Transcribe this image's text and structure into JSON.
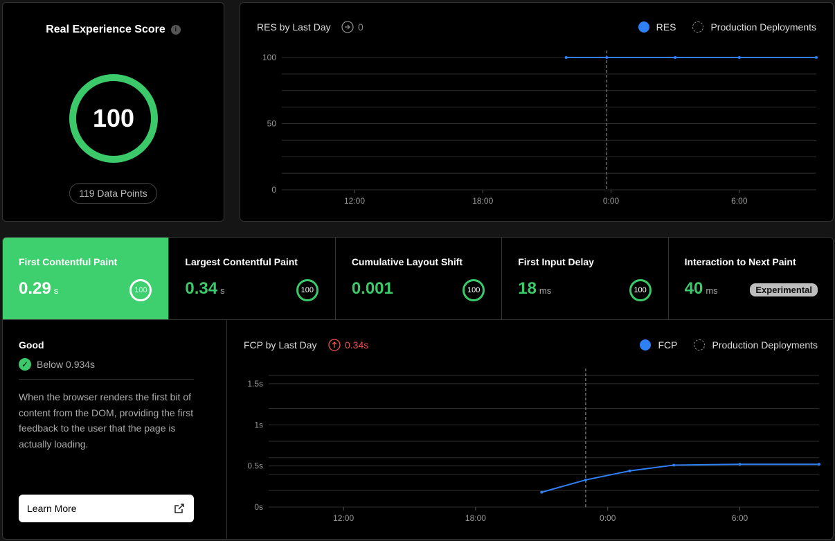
{
  "score_card": {
    "title": "Real Experience Score",
    "info_icon": "info-icon",
    "score": "100",
    "data_points": "119 Data Points",
    "color": "#3bc96a"
  },
  "res_chart": {
    "title": "RES by Last Day",
    "badge_icon": "arrow-right-circle-icon",
    "badge_value": "0",
    "legend": {
      "series": "RES",
      "deployments": "Production Deployments"
    }
  },
  "metrics": {
    "tabs": [
      {
        "label": "First Contentful Paint",
        "value": "0.29",
        "unit": "s",
        "score": "100",
        "active": true
      },
      {
        "label": "Largest Contentful Paint",
        "value": "0.34",
        "unit": "s",
        "score": "100",
        "active": false
      },
      {
        "label": "Cumulative Layout Shift",
        "value": "0.001",
        "unit": "",
        "score": "100",
        "active": false
      },
      {
        "label": "First Input Delay",
        "value": "18",
        "unit": "ms",
        "score": "100",
        "active": false
      },
      {
        "label": "Interaction to Next Paint",
        "value": "40",
        "unit": "ms",
        "badge": "Experimental",
        "active": false
      }
    ]
  },
  "description": {
    "status": "Good",
    "threshold": "Below 0.934s",
    "text": "When the browser renders the first bit of content from the DOM, providing the first feedback to the user that the page is actually loading.",
    "button": "Learn More",
    "button_icon": "external-link-icon"
  },
  "fcp_chart": {
    "title": "FCP by Last Day",
    "badge_icon": "arrow-up-circle-icon",
    "badge_value": "0.34s",
    "badge_color": "#f0524f",
    "legend": {
      "series": "FCP",
      "deployments": "Production Deployments"
    }
  },
  "chart_data": [
    {
      "type": "line",
      "title": "RES by Last Day",
      "x_ticks": [
        "12:00",
        "18:00",
        "0:00",
        "6:00"
      ],
      "y_ticks": [
        "100",
        "50",
        "0"
      ],
      "ylim": [
        0,
        100
      ],
      "x_range_hours": [
        8.6,
        33.6
      ],
      "series": [
        {
          "name": "RES",
          "color": "#2f7ff5",
          "x_hours": [
            21.9,
            23.8,
            27.0,
            30.0,
            33.6
          ],
          "values": [
            100,
            100,
            100,
            100,
            100
          ]
        }
      ],
      "deployment_x_hours": 23.8,
      "grid": true
    },
    {
      "type": "line",
      "title": "FCP by Last Day",
      "x_ticks": [
        "12:00",
        "18:00",
        "0:00",
        "6:00"
      ],
      "y_ticks": [
        "1.5s",
        "1s",
        "0.5s",
        "0s"
      ],
      "ylim": [
        0,
        1.6
      ],
      "x_range_hours": [
        8.6,
        33.6
      ],
      "series": [
        {
          "name": "FCP",
          "color": "#2f7ff5",
          "x_hours": [
            21.0,
            23.0,
            25.0,
            27.0,
            30.0,
            33.6
          ],
          "values": [
            0.18,
            0.33,
            0.44,
            0.51,
            0.52,
            0.52
          ]
        }
      ],
      "deployment_x_hours": 23.0,
      "grid": true
    }
  ]
}
